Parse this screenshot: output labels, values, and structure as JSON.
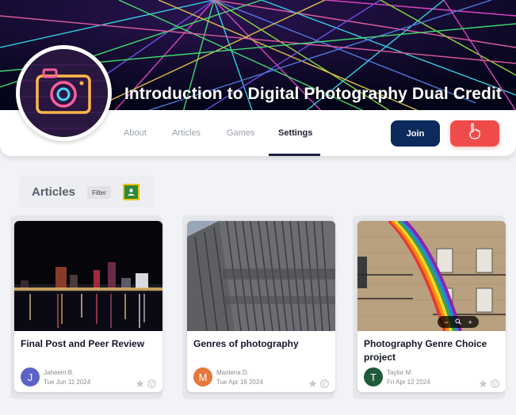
{
  "course": {
    "title": "Introduction to Digital Photography Dual Credit"
  },
  "nav": {
    "tabs": [
      {
        "label": "About"
      },
      {
        "label": "Articles"
      },
      {
        "label": "Games"
      },
      {
        "label": "Settings"
      }
    ],
    "active_tab": "Settings",
    "join_label": "Join"
  },
  "articles_section": {
    "title": "Articles",
    "filter_label": "Filter"
  },
  "cards": [
    {
      "title": "Final Post and Peer Review",
      "author": "Jaheem B.",
      "initial": "J",
      "avatar_color": "#5b64c4",
      "date": "Tue Jun 11 2024"
    },
    {
      "title": "Genres of photography",
      "author": "Marilena D.",
      "initial": "M",
      "avatar_color": "#e5783b",
      "date": "Tue Apr 16 2024"
    },
    {
      "title": "Photography Genre Choice project",
      "author": "Taylor M",
      "initial": "T",
      "avatar_color": "#1f5a3a",
      "date": "Fri Apr 12 2024"
    }
  ],
  "image_viewer": {
    "minus": "−",
    "plus": "+"
  },
  "colors": {
    "join_button": "#0d2a5c",
    "raise_hand_button": "#f04b4b",
    "active_tab_underline": "#1e2140"
  },
  "icons": [
    "camera-icon",
    "raise-hand-icon",
    "google-classroom-icon",
    "star-icon",
    "globe-icon",
    "zoom-icon"
  ]
}
